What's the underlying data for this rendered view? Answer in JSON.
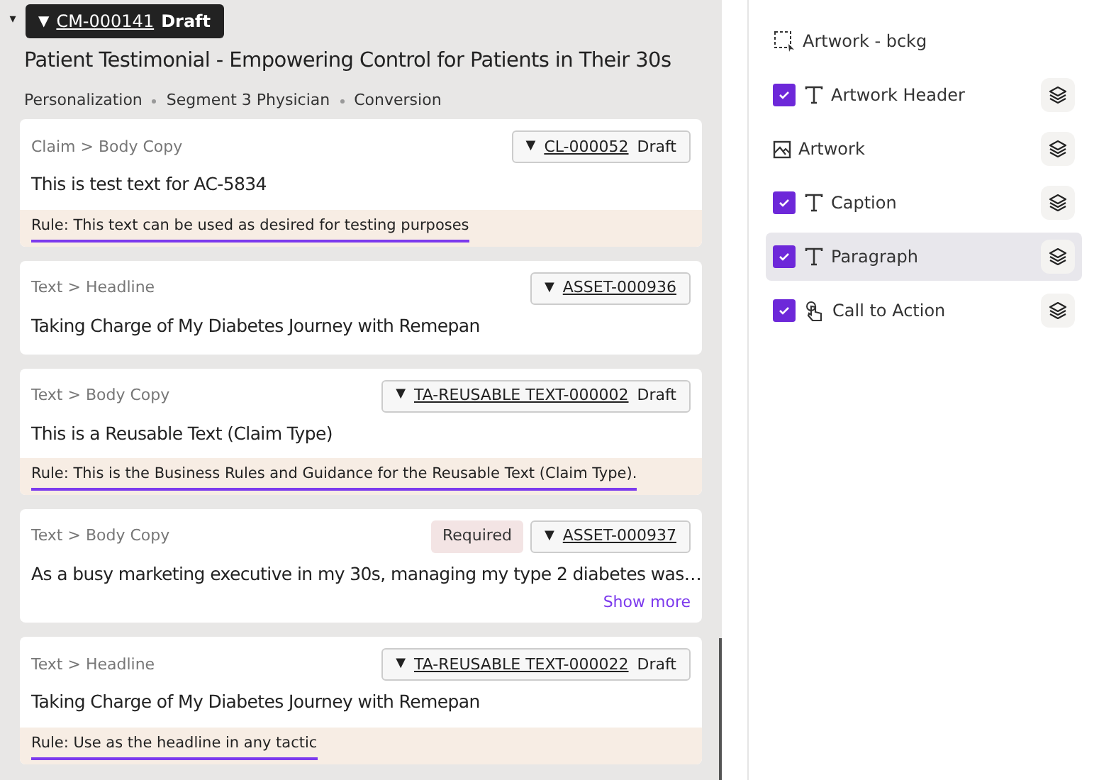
{
  "header": {
    "collapse_icon": "▾",
    "tag": {
      "icon": "▼",
      "id": "CM-000141",
      "status": "Draft"
    },
    "title": "Patient Testimonial - Empowering Control for Patients in Their 30s",
    "meta": [
      "Personalization",
      "Segment 3 Physician",
      "Conversion"
    ]
  },
  "cards": [
    {
      "breadcrumb": "Claim > Body Copy",
      "tag": {
        "icon": "▼",
        "id": "CL-000052",
        "status": "Draft"
      },
      "text": "This is test text for AC-5834",
      "rule": "Rule: This text can be used as desired for testing purposes"
    },
    {
      "breadcrumb": "Text > Headline",
      "tag": {
        "icon": "▼",
        "id": "ASSET-000936"
      },
      "text": "Taking Charge of My Diabetes Journey with Remepan"
    },
    {
      "breadcrumb": "Text > Body Copy",
      "tag": {
        "icon": "▼",
        "id": "TA-REUSABLE TEXT-000002",
        "status": "Draft"
      },
      "text": "This is a Reusable Text (Claim Type)",
      "rule": "Rule: This is the Business Rules and Guidance for the Reusable Text (Claim Type)."
    },
    {
      "breadcrumb": "Text > Body Copy",
      "badge": "Required",
      "tag": {
        "icon": "▼",
        "id": "ASSET-000937"
      },
      "text": "As a busy marketing executive in my 30s, managing my type 2 diabetes was…",
      "link": "Show more"
    },
    {
      "breadcrumb": "Text > Headline",
      "tag": {
        "icon": "▼",
        "id": "TA-REUSABLE TEXT-000022",
        "status": "Draft"
      },
      "text": "Taking Charge of My Diabetes Journey with Remepan",
      "rule": "Rule: Use as the headline in any tactic"
    }
  ],
  "layers": [
    {
      "kind": "frame",
      "label": "Artwork - bckg",
      "layers_button": false,
      "selected": false
    },
    {
      "kind": "text",
      "label": "Artwork Header",
      "checked": true,
      "layers_button": true,
      "selected": false
    },
    {
      "kind": "image",
      "label": "Artwork",
      "layers_button": true,
      "selected": false
    },
    {
      "kind": "text",
      "label": "Caption",
      "checked": true,
      "layers_button": true,
      "selected": false
    },
    {
      "kind": "text",
      "label": "Paragraph",
      "checked": true,
      "layers_button": true,
      "selected": true
    },
    {
      "kind": "cta",
      "label": "Call to Action",
      "checked": true,
      "layers_button": true,
      "selected": false
    }
  ]
}
